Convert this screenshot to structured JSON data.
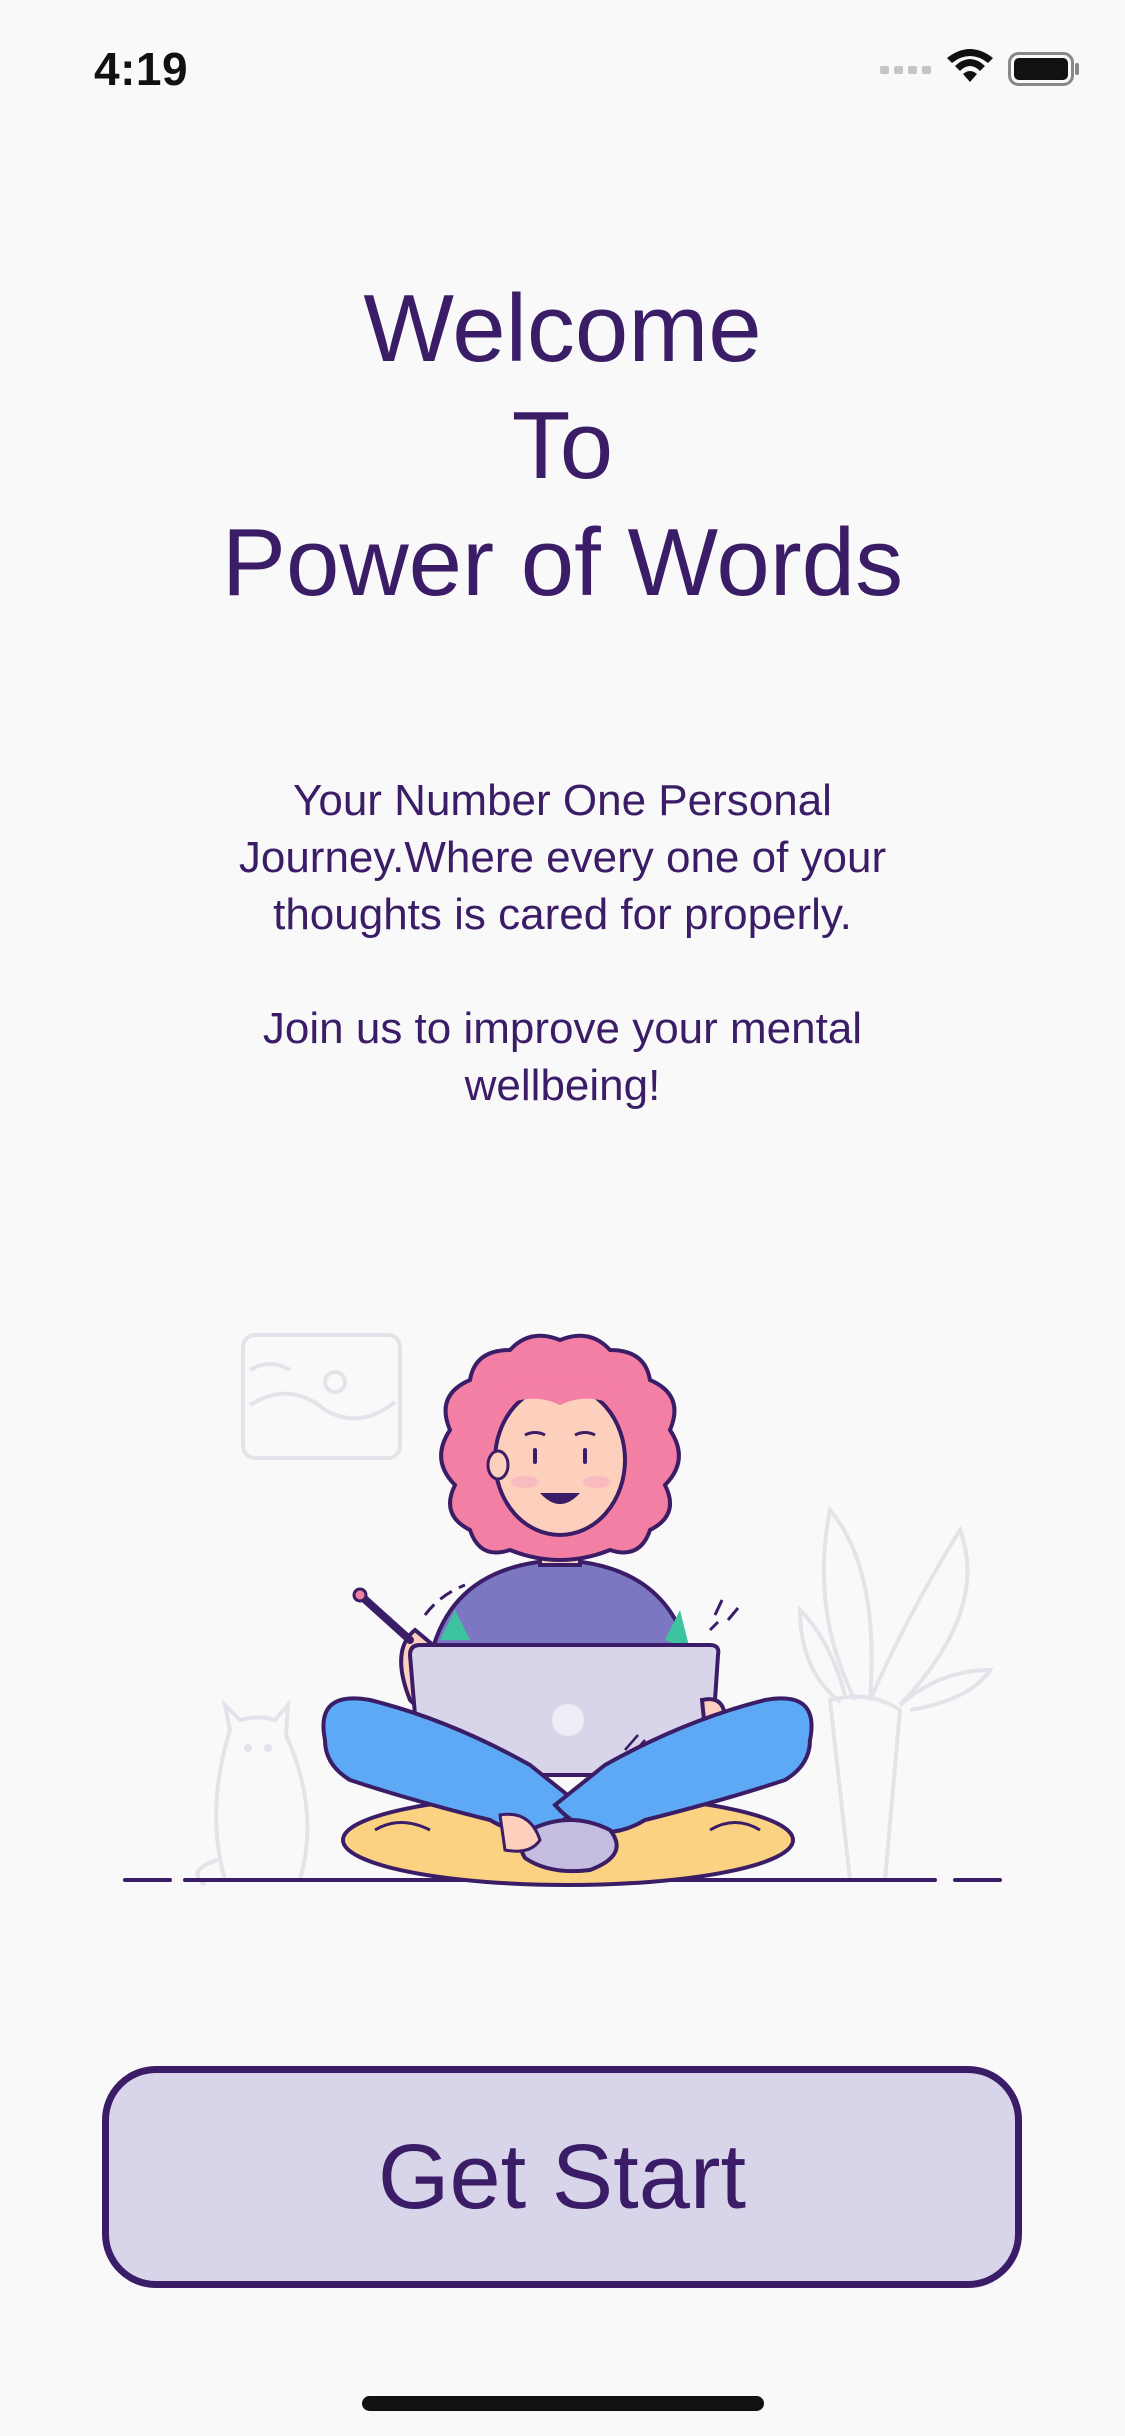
{
  "status_bar": {
    "time": "4:19",
    "icons": [
      "cellular-signal-icon",
      "wifi-icon",
      "battery-icon"
    ]
  },
  "welcome": {
    "title_lines": [
      "Welcome",
      "To",
      "Power of Words"
    ],
    "description_1": "Your Number One Personal Journey.Where every one of your thoughts is cared for properly.",
    "description_2": "Join us to improve your mental wellbeing!"
  },
  "illustration": {
    "subject": "person-with-laptop-illustration"
  },
  "actions": {
    "get_start_label": "Get Start"
  },
  "colors": {
    "primary": "#3a1d66",
    "button_fill": "#d8d4ea",
    "background": "#f9f9fa",
    "hair": "#f47fa5",
    "pants": "#5ea9f5",
    "cushion": "#fbd282"
  }
}
